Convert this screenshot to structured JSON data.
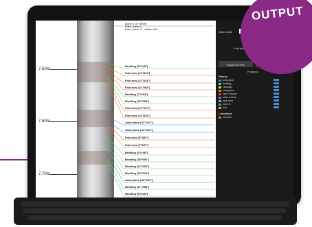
{
  "badge": {
    "label": "OUTPUT"
  },
  "depth_labels": [
    "7.50m",
    "7.60m",
    "7.70m"
  ],
  "features": [
    {
      "label": "plane 8 (17.5939)\nDate: plane 3\nNote: plane 3 - calcite infill"
    },
    {
      "label": "Bedding [6°/249°]"
    },
    {
      "label": "Fold axis [21°/311°]"
    },
    {
      "label": "Fold axis [21°/225°]"
    },
    {
      "label": "Fold axis [11°/282°]"
    },
    {
      "label": "Bedding [7°/284°]"
    },
    {
      "label": "Bedding [10°/084°]"
    },
    {
      "label": "Fold axis [31°/127°]"
    },
    {
      "label": "Fold axis [14°/334°]"
    },
    {
      "label": "Axial plane [47°/224°]"
    },
    {
      "label": "Axial plane [31°/212°]"
    },
    {
      "label": "Fold axis [8°/383°]"
    },
    {
      "label": "Fold axis [7°/297°]"
    },
    {
      "label": "Bedding [6°/198°]"
    },
    {
      "label": "Bedding [30°/097°]"
    },
    {
      "label": "Bedding [12°/287°]"
    },
    {
      "label": "Bedding [15°/316°]"
    },
    {
      "label": "Axial plane [38°/231°]"
    },
    {
      "label": "Bedding [17°/058°]"
    },
    {
      "label": "Bedding [8°/018°]"
    }
  ],
  "sidebar": {
    "start_depth_label": "Start Depth",
    "start_depth_value": "7.50",
    "font_size_label": "Font size",
    "apply_label": "Apply",
    "export_png_label": "Export to PNG",
    "export_pdf_label": "Export to PDF",
    "features_heading": "Features",
    "planes_heading": "Planes",
    "lineations_heading": "Lineations",
    "planes": [
      {
        "name": "joint plane",
        "color": "#3c8fd8"
      },
      {
        "name": "bedding",
        "color": "#6fd06f"
      },
      {
        "name": "cleavage",
        "color": "#d9d94a"
      },
      {
        "name": "axial plane",
        "color": "#e37b2b"
      },
      {
        "name": "vein / fracture",
        "color": "#cc4444"
      },
      {
        "name": "other feature",
        "color": "#b04fc7"
      },
      {
        "name": "fault zone",
        "color": "#44c7c7"
      },
      {
        "name": "plane 8",
        "color": "#888888"
      },
      {
        "name": "fold",
        "color": "#e3a04a"
      }
    ],
    "lineations": [
      {
        "name": "fold axis",
        "color": "#e37b2b"
      }
    ],
    "edit_label": "Edit"
  }
}
